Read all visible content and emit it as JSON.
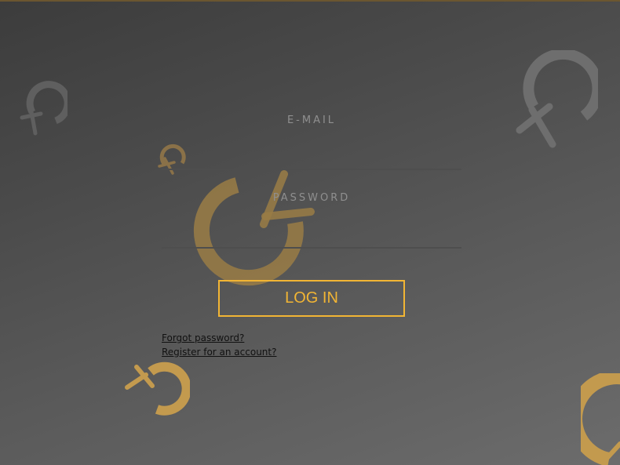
{
  "login": {
    "email_label": "E-MAIL",
    "email_value": "",
    "password_label": "PASSWORD",
    "password_value": "",
    "submit_label": "LOG IN",
    "forgot_link": "Forgot password?",
    "register_link": "Register for an account?"
  },
  "decorations": {
    "icon": "sword-ring-logo",
    "gold_color": "#c39a4e",
    "grey_color": "#6e6e6e"
  },
  "colors": {
    "accent": "#f2b534",
    "background_dark": "#3c3c3c",
    "background_light": "#6c6c6c",
    "link": "#111111"
  }
}
